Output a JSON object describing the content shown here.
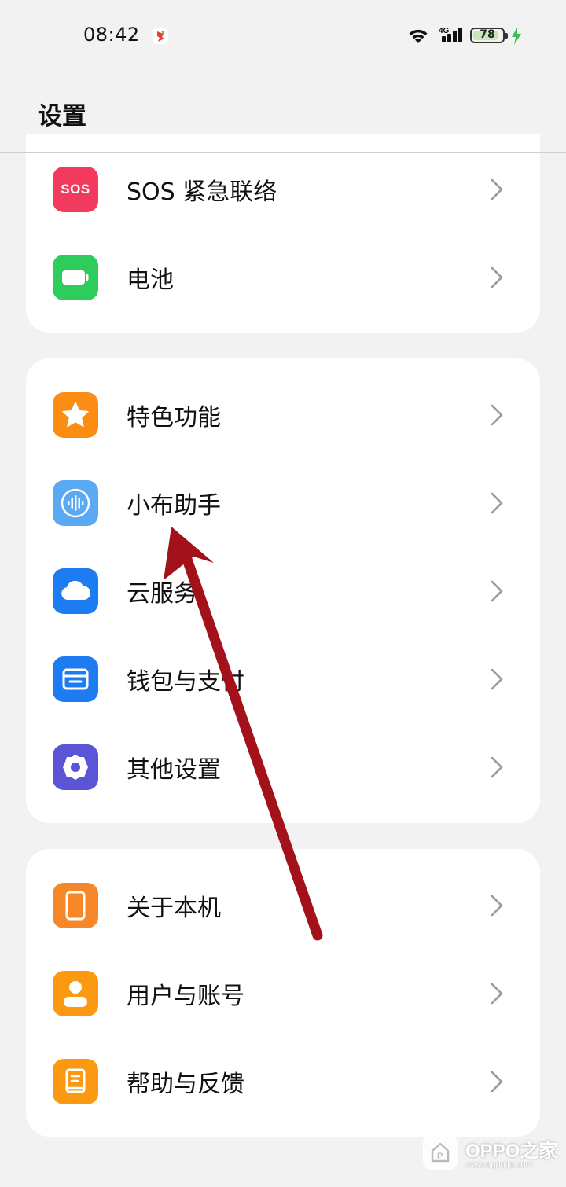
{
  "status_bar": {
    "time": "08:42",
    "network": "4G",
    "battery_level": "78",
    "charging": true
  },
  "header": {
    "title": "设置"
  },
  "groups": [
    {
      "items": [
        {
          "label": "SOS 紧急联络",
          "icon": "sos-icon",
          "icon_text": "SOS",
          "color": "#f23a5f"
        },
        {
          "label": "电池",
          "icon": "battery-icon",
          "color": "#2ecc5a"
        }
      ]
    },
    {
      "items": [
        {
          "label": "特色功能",
          "icon": "star-icon",
          "color": "#fb8c14"
        },
        {
          "label": "小布助手",
          "icon": "voice-assistant-icon",
          "color": "#5aa9f5"
        },
        {
          "label": "云服务",
          "icon": "cloud-icon",
          "color": "#1d7cf2"
        },
        {
          "label": "钱包与支付",
          "icon": "wallet-icon",
          "color": "#1d7cf2"
        },
        {
          "label": "其他设置",
          "icon": "gear-icon",
          "color": "#5b55d6"
        }
      ]
    },
    {
      "items": [
        {
          "label": "关于本机",
          "icon": "phone-icon",
          "color": "#f7882a"
        },
        {
          "label": "用户与账号",
          "icon": "user-icon",
          "color": "#fb9912"
        },
        {
          "label": "帮助与反馈",
          "icon": "help-book-icon",
          "color": "#fb9912"
        }
      ]
    }
  ],
  "annotation_color": "#a3121a",
  "watermark": {
    "name": "OPPO之家",
    "url": "www.oppojia.com"
  }
}
